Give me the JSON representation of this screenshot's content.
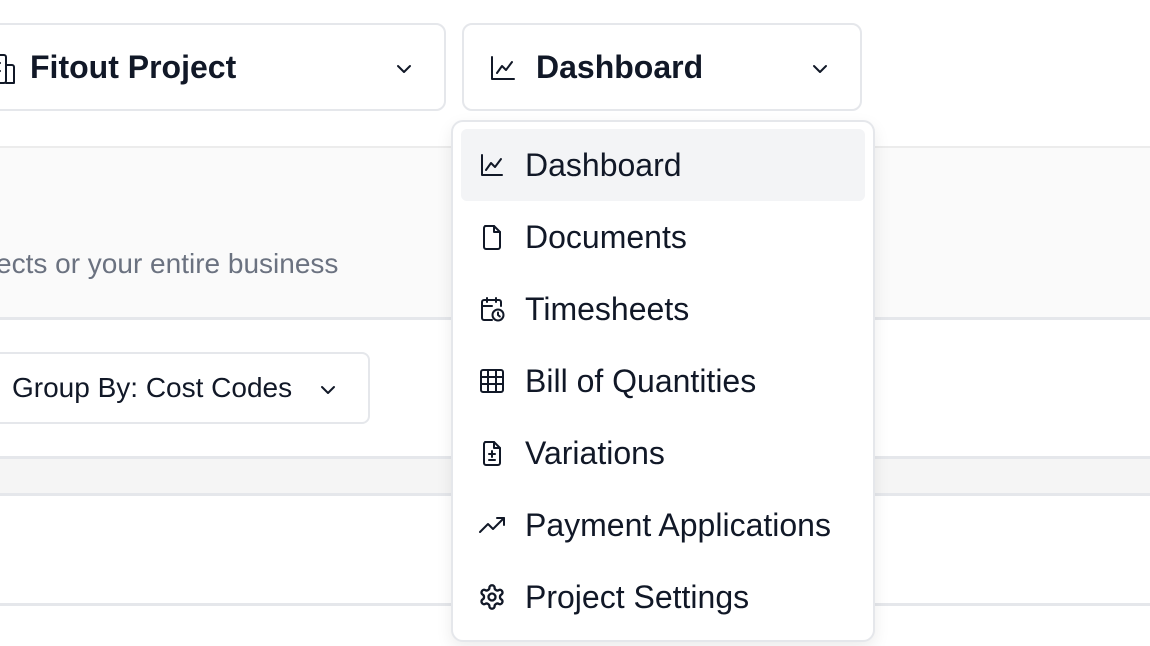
{
  "header": {
    "project_selector": {
      "label": "Fitout Project",
      "icon": "building-icon"
    },
    "view_selector": {
      "label": "Dashboard",
      "icon": "line-chart-icon"
    }
  },
  "page": {
    "subtitle": "ects or your entire business",
    "group_by_label": "Group By: Cost Codes"
  },
  "menu": {
    "items": [
      {
        "label": "Dashboard",
        "icon": "line-chart-icon",
        "active": true
      },
      {
        "label": "Documents",
        "icon": "file-icon"
      },
      {
        "label": "Timesheets",
        "icon": "calendar-clock-icon"
      },
      {
        "label": "Bill of Quantities",
        "icon": "table-icon"
      },
      {
        "label": "Variations",
        "icon": "file-plus-minus-icon"
      },
      {
        "label": "Payment Applications",
        "icon": "trending-up-icon"
      },
      {
        "label": "Project Settings",
        "icon": "gear-icon"
      }
    ]
  }
}
